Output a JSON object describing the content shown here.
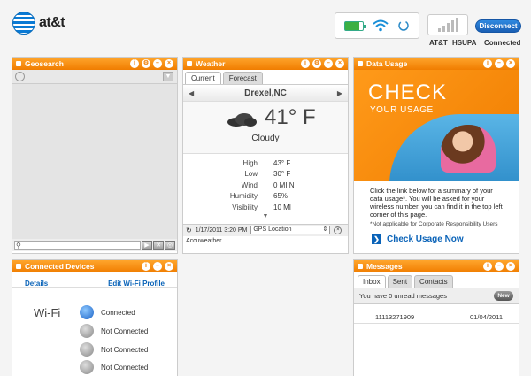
{
  "header": {
    "brand": "at&t",
    "carrier": "AT&T",
    "network": "HSUPA",
    "connection_status": "Connected",
    "disconnect_label": "Disconnect"
  },
  "geosearch": {
    "title": "Geosearch"
  },
  "weather": {
    "title": "Weather",
    "tabs": [
      "Current",
      "Forecast"
    ],
    "location": "Drexel,NC",
    "temperature": "41° F",
    "condition": "Cloudy",
    "details": [
      {
        "label": "High",
        "value": "43° F"
      },
      {
        "label": "Low",
        "value": "30° F"
      },
      {
        "label": "Wind",
        "value": "0 MI N"
      },
      {
        "label": "Humidity",
        "value": "65%"
      },
      {
        "label": "Visibility",
        "value": "10 MI"
      }
    ],
    "timestamp": "1/17/2011 3:20 PM",
    "location_source": "GPS Location",
    "provider": "Accuweather"
  },
  "data_usage": {
    "title": "Data Usage",
    "banner_big": "CHECK",
    "banner_small": "YOUR USAGE",
    "description": "Click the link below for a summary of your data usage*. You will be asked for your wireless number, you can find it in the top left corner of this page.",
    "note": "*Not applicable for Corporate Responsibility Users",
    "link": "Check Usage Now"
  },
  "connected_devices": {
    "title": "Connected Devices",
    "details_link": "Details",
    "edit_link": "Edit Wi-Fi Profile",
    "wifi_label": "Wi-Fi",
    "devices": [
      "Connected",
      "Not Connected",
      "Not Connected",
      "Not Connected"
    ]
  },
  "messages": {
    "title": "Messages",
    "tabs": [
      "Inbox",
      "Sent",
      "Contacts"
    ],
    "unread": "You have 0 unread messages",
    "new_label": "New",
    "items": [
      {
        "from": "11113271909",
        "date": "01/04/2011"
      }
    ]
  }
}
